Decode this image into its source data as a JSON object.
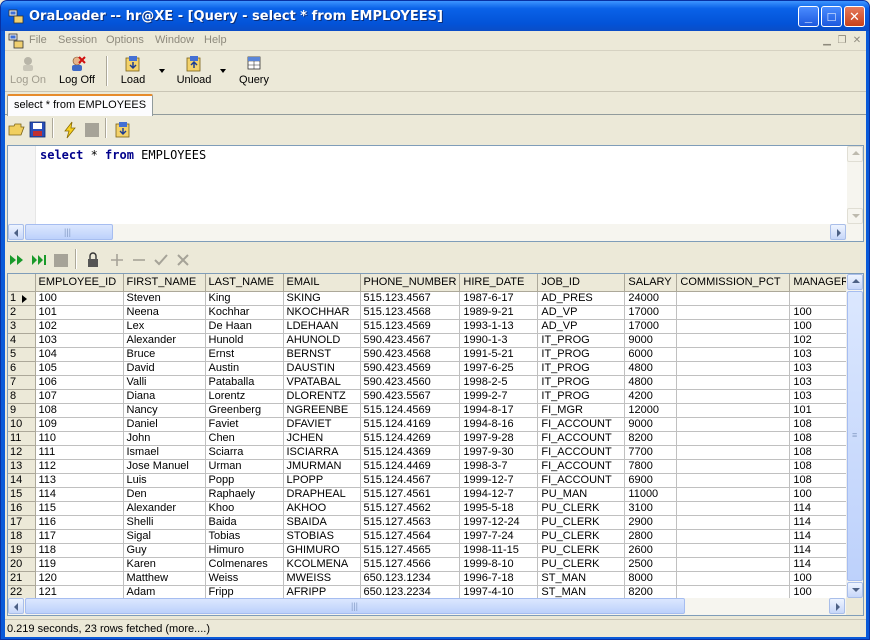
{
  "window": {
    "title": "OraLoader -- hr@XE - [Query - select * from EMPLOYEES]",
    "minimize": "_",
    "maximize": "□",
    "close": "✕"
  },
  "menu": [
    "File",
    "Session",
    "Options",
    "Window",
    "Help"
  ],
  "toolbar": {
    "logon": "Log On",
    "logoff": "Log Off",
    "load": "Load",
    "unload": "Unload",
    "query": "Query"
  },
  "tab": {
    "label": "select * from EMPLOYEES"
  },
  "editor": {
    "kw_select": "select",
    "star": " * ",
    "kw_from": "from",
    "table": " EMPLOYEES"
  },
  "grid": {
    "columns": [
      "EMPLOYEE_ID",
      "FIRST_NAME",
      "LAST_NAME",
      "EMAIL",
      "PHONE_NUMBER",
      "HIRE_DATE",
      "JOB_ID",
      "SALARY",
      "COMMISSION_PCT",
      "MANAGER_I"
    ],
    "rows": [
      [
        "1",
        "100",
        "Steven",
        "King",
        "SKING",
        "515.123.4567",
        "1987-6-17",
        "AD_PRES",
        "24000",
        "",
        ""
      ],
      [
        "2",
        "101",
        "Neena",
        "Kochhar",
        "NKOCHHAR",
        "515.123.4568",
        "1989-9-21",
        "AD_VP",
        "17000",
        "",
        "100"
      ],
      [
        "3",
        "102",
        "Lex",
        "De Haan",
        "LDEHAAN",
        "515.123.4569",
        "1993-1-13",
        "AD_VP",
        "17000",
        "",
        "100"
      ],
      [
        "4",
        "103",
        "Alexander",
        "Hunold",
        "AHUNOLD",
        "590.423.4567",
        "1990-1-3",
        "IT_PROG",
        "9000",
        "",
        "102"
      ],
      [
        "5",
        "104",
        "Bruce",
        "Ernst",
        "BERNST",
        "590.423.4568",
        "1991-5-21",
        "IT_PROG",
        "6000",
        "",
        "103"
      ],
      [
        "6",
        "105",
        "David",
        "Austin",
        "DAUSTIN",
        "590.423.4569",
        "1997-6-25",
        "IT_PROG",
        "4800",
        "",
        "103"
      ],
      [
        "7",
        "106",
        "Valli",
        "Pataballa",
        "VPATABAL",
        "590.423.4560",
        "1998-2-5",
        "IT_PROG",
        "4800",
        "",
        "103"
      ],
      [
        "8",
        "107",
        "Diana",
        "Lorentz",
        "DLORENTZ",
        "590.423.5567",
        "1999-2-7",
        "IT_PROG",
        "4200",
        "",
        "103"
      ],
      [
        "9",
        "108",
        "Nancy",
        "Greenberg",
        "NGREENBE",
        "515.124.4569",
        "1994-8-17",
        "FI_MGR",
        "12000",
        "",
        "101"
      ],
      [
        "10",
        "109",
        "Daniel",
        "Faviet",
        "DFAVIET",
        "515.124.4169",
        "1994-8-16",
        "FI_ACCOUNT",
        "9000",
        "",
        "108"
      ],
      [
        "11",
        "110",
        "John",
        "Chen",
        "JCHEN",
        "515.124.4269",
        "1997-9-28",
        "FI_ACCOUNT",
        "8200",
        "",
        "108"
      ],
      [
        "12",
        "111",
        "Ismael",
        "Sciarra",
        "ISCIARRA",
        "515.124.4369",
        "1997-9-30",
        "FI_ACCOUNT",
        "7700",
        "",
        "108"
      ],
      [
        "13",
        "112",
        "Jose Manuel",
        "Urman",
        "JMURMAN",
        "515.124.4469",
        "1998-3-7",
        "FI_ACCOUNT",
        "7800",
        "",
        "108"
      ],
      [
        "14",
        "113",
        "Luis",
        "Popp",
        "LPOPP",
        "515.124.4567",
        "1999-12-7",
        "FI_ACCOUNT",
        "6900",
        "",
        "108"
      ],
      [
        "15",
        "114",
        "Den",
        "Raphaely",
        "DRAPHEAL",
        "515.127.4561",
        "1994-12-7",
        "PU_MAN",
        "11000",
        "",
        "100"
      ],
      [
        "16",
        "115",
        "Alexander",
        "Khoo",
        "AKHOO",
        "515.127.4562",
        "1995-5-18",
        "PU_CLERK",
        "3100",
        "",
        "114"
      ],
      [
        "17",
        "116",
        "Shelli",
        "Baida",
        "SBAIDA",
        "515.127.4563",
        "1997-12-24",
        "PU_CLERK",
        "2900",
        "",
        "114"
      ],
      [
        "18",
        "117",
        "Sigal",
        "Tobias",
        "STOBIAS",
        "515.127.4564",
        "1997-7-24",
        "PU_CLERK",
        "2800",
        "",
        "114"
      ],
      [
        "19",
        "118",
        "Guy",
        "Himuro",
        "GHIMURO",
        "515.127.4565",
        "1998-11-15",
        "PU_CLERK",
        "2600",
        "",
        "114"
      ],
      [
        "20",
        "119",
        "Karen",
        "Colmenares",
        "KCOLMENA",
        "515.127.4566",
        "1999-8-10",
        "PU_CLERK",
        "2500",
        "",
        "114"
      ],
      [
        "21",
        "120",
        "Matthew",
        "Weiss",
        "MWEISS",
        "650.123.1234",
        "1996-7-18",
        "ST_MAN",
        "8000",
        "",
        "100"
      ],
      [
        "22",
        "121",
        "Adam",
        "Fripp",
        "AFRIPP",
        "650.123.2234",
        "1997-4-10",
        "ST_MAN",
        "8200",
        "",
        "100"
      ]
    ]
  },
  "status": {
    "text": "0.219 seconds,  23 rows fetched (more....)"
  },
  "colors": {
    "titlebar": "#0a5ad9",
    "tab_accent": "#e68b2c",
    "keyword": "#00008b"
  }
}
